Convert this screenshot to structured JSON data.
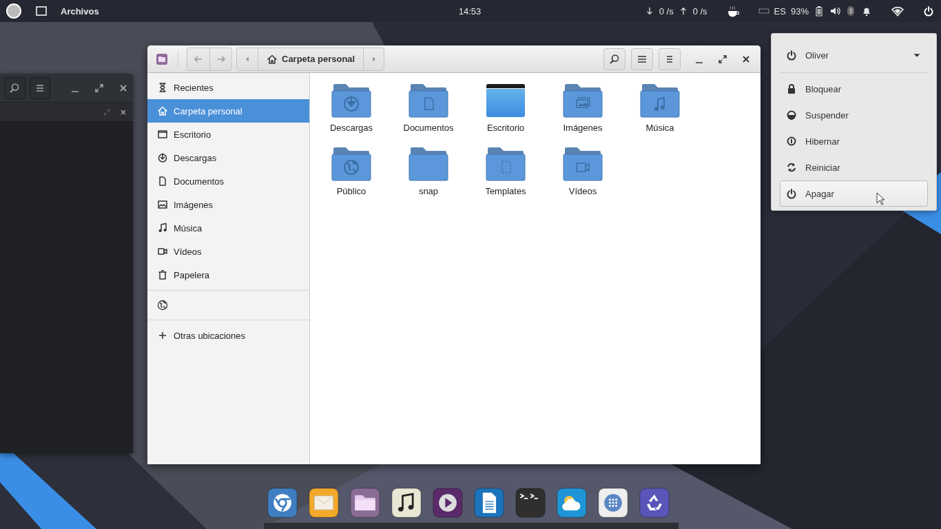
{
  "topbar": {
    "app_name": "Archivos",
    "clock": "14:53",
    "download_rate": "0 /s",
    "upload_rate": "0 /s",
    "keyboard_layout": "ES",
    "battery": "93%"
  },
  "file_manager": {
    "path": "Carpeta personal",
    "sidebar": {
      "places": [
        {
          "label": "Recientes",
          "selected": false
        },
        {
          "label": "Carpeta personal",
          "selected": true
        },
        {
          "label": "Escritorio",
          "selected": false
        },
        {
          "label": "Descargas",
          "selected": false
        },
        {
          "label": "Documentos",
          "selected": false
        },
        {
          "label": "Imágenes",
          "selected": false
        },
        {
          "label": "Música",
          "selected": false
        },
        {
          "label": "Vídeos",
          "selected": false
        },
        {
          "label": "Papelera",
          "selected": false
        }
      ],
      "other_locations": "Otras ubicaciones"
    },
    "folders": [
      {
        "name": "Descargas"
      },
      {
        "name": "Documentos"
      },
      {
        "name": "Escritorio"
      },
      {
        "name": "Imágenes"
      },
      {
        "name": "Música"
      },
      {
        "name": "Público"
      },
      {
        "name": "snap"
      },
      {
        "name": "Templates"
      },
      {
        "name": "Vídeos"
      }
    ]
  },
  "power_menu": {
    "user": "Oliver",
    "items": [
      {
        "label": "Bloquear",
        "selected": false
      },
      {
        "label": "Suspender",
        "selected": false
      },
      {
        "label": "Hibernar",
        "selected": false
      },
      {
        "label": "Reiniciar",
        "selected": false
      },
      {
        "label": "Apagar",
        "selected": true
      }
    ]
  }
}
